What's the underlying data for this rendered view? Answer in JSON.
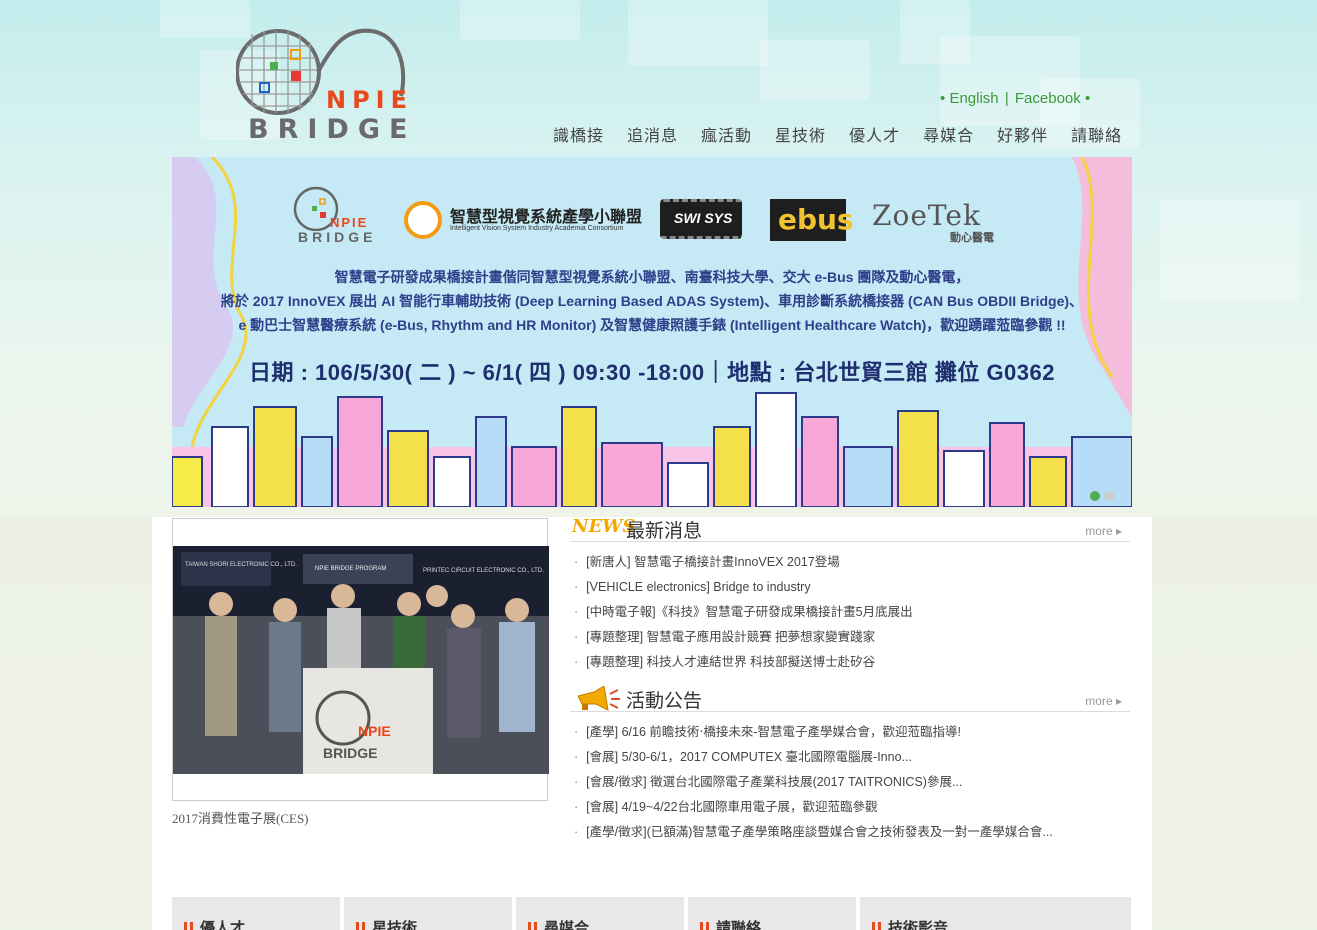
{
  "logo": {
    "npie": "NPIE",
    "bridge": "BRIDGE"
  },
  "toplinks": {
    "bullet_left": "•",
    "english": "English",
    "sep": "|",
    "facebook": "Facebook",
    "bullet_right": "•"
  },
  "nav": [
    "識橋接",
    "追消息",
    "瘋活動",
    "星技術",
    "優人才",
    "尋媒合",
    "好夥伴",
    "請聯絡"
  ],
  "banner": {
    "logo_npie": "NPIE",
    "logo_bridge": "BRIDGE",
    "ivs_title": "智慧型視覺系統產學小聯盟",
    "ivs_sub": "Intelligent Vision System Industry Academia Consortium",
    "swi": "SWI SYS",
    "ebus": "ebus",
    "zoe": "ZoeTek",
    "zoe_sub": "動心醫電",
    "line1": "智慧電子研發成果橋接計畫偕同智慧型視覺系統小聯盟、南臺科技大學、交大 e-Bus 團隊及動心醫電，",
    "line2": "將於 2017 InnoVEX 展出 AI 智能行車輔助技術 (Deep Learning Based ADAS System)、車用診斷系統橋接器 (CAN Bus OBDII Bridge)、",
    "line3": "e 動巴士智慧醫療系統 (e-Bus, Rhythm and HR Monitor) 及智慧健康照護手錶 (Intelligent Healthcare Watch)，歡迎踴躍蒞臨參觀 !!",
    "date": "日期 : 106/5/30( 二 ) ~ 6/1( 四 ) 09:30 -18:00｜地點 : 台北世貿三館 攤位 G0362"
  },
  "photo": {
    "caption": "2017消費性電子展(CES)",
    "booth_sign": "NPIE BRIDGE PROGRAM",
    "left_sign": "TAIWAN SHORI ELECTRONIC CO., LTD.",
    "right_sign": "PRINTEC CIRCUIT ELECTRONIC CO., LTD.",
    "flag_npie": "NPIE",
    "flag_bridge": "BRIDGE"
  },
  "news": {
    "tag": "NEWS",
    "title": "最新消息",
    "more": "more ▸",
    "items": [
      "[新唐人] 智慧電子橋接計畫InnoVEX 2017登場",
      "[VEHICLE electronics] Bridge to industry",
      "[中時電子報]《科技》智慧電子研發成果橋接計畫5月底展出",
      "[專題整理] 智慧電子應用設計競賽 把夢想家變實踐家",
      "[專題整理] 科技人才連結世界 科技部擬送博士赴矽谷"
    ]
  },
  "events": {
    "title": "活動公告",
    "more": "more ▸",
    "items": [
      "[產學] 6/16 前瞻技術‧橋接未來-智慧電子產學媒合會，歡迎蒞臨指導!",
      "[會展] 5/30-6/1，2017 COMPUTEX 臺北國際電腦展-Inno...",
      "[會展/徵求] 徵選台北國際電子產業科技展(2017 TAITRONICS)參展...",
      "[會展] 4/19~4/22台北國際車用電子展，歡迎蒞臨參觀",
      "[產學/徵求](已額滿)智慧電子產學策略座談暨媒合會之技術發表及一對一產學媒合會..."
    ]
  },
  "tabs": [
    "優人才",
    "星技術",
    "尋媒合",
    "請聯絡",
    "技術影音"
  ],
  "colors": {
    "nav_text": "#444444",
    "link_green": "#3a9a3a",
    "accent_orange": "#e34a1d",
    "banner_bg": "#c5e9f5"
  }
}
